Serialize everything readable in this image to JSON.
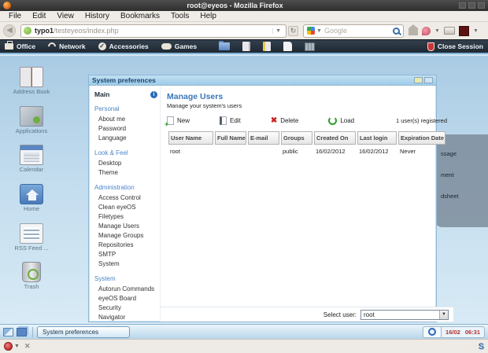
{
  "browser": {
    "title": "root@eyeos - Mozilla Firefox",
    "menus": [
      "File",
      "Edit",
      "View",
      "History",
      "Bookmarks",
      "Tools",
      "Help"
    ],
    "url_host": "typo1",
    "url_path": "/testeyeos/index.php",
    "search_placeholder": "Google"
  },
  "eyeos_bar": {
    "menus": [
      "Office",
      "Network",
      "Accessories",
      "Games"
    ],
    "close_session": "Close Session"
  },
  "desktop_icons": [
    {
      "label": "Address Book"
    },
    {
      "label": "Applications"
    },
    {
      "label": "Calendar"
    },
    {
      "label": "Home"
    },
    {
      "label": "RSS Feed ..."
    },
    {
      "label": "Trash"
    }
  ],
  "dock": {
    "fragments": [
      "ssage",
      "ment",
      "dsheet"
    ]
  },
  "window": {
    "title": "System preferences",
    "nav": {
      "main_label": "Main",
      "sections": [
        {
          "title": "Personal",
          "items": [
            "About me",
            "Password",
            "Language"
          ]
        },
        {
          "title": "Look & Feel",
          "items": [
            "Desktop",
            "Theme"
          ]
        },
        {
          "title": "Administration",
          "items": [
            "Access Control",
            "Clean eyeOS",
            "Filetypes",
            "Manage Users",
            "Manage Groups",
            "Repositories",
            "SMTP",
            "System"
          ]
        },
        {
          "title": "System",
          "items": [
            "Autorun Commands",
            "eyeOS Board",
            "Security",
            "Navigator"
          ]
        }
      ]
    },
    "content": {
      "title": "Manage Users",
      "subtitle": "Manage your system's users",
      "toolbar": {
        "new": "New",
        "edit": "Edit",
        "delete": "Delete",
        "load": "Load",
        "registered": "1 user(s) registered"
      },
      "table": {
        "headers": [
          "User Name",
          "Full Name",
          "E-mail",
          "Groups",
          "Created On",
          "Last login",
          "Expiration Date"
        ],
        "rows": [
          [
            "root",
            "",
            "",
            "public",
            "16/02/2012",
            "16/02/2012",
            "Never"
          ]
        ]
      },
      "select_user_label": "Select user:",
      "select_user_value": "root"
    }
  },
  "taskbar": {
    "task_button": "System preferences",
    "clock_date": "16/02",
    "clock_time": "06:31"
  },
  "icons": {
    "favicon_color": "#6faf3a",
    "accent_blue": "#3a77b8",
    "titlebar_dark": "#2e3a46",
    "delete_red": "#cc2222",
    "load_green": "#2e9e2e",
    "clock_red": "#b03030"
  }
}
